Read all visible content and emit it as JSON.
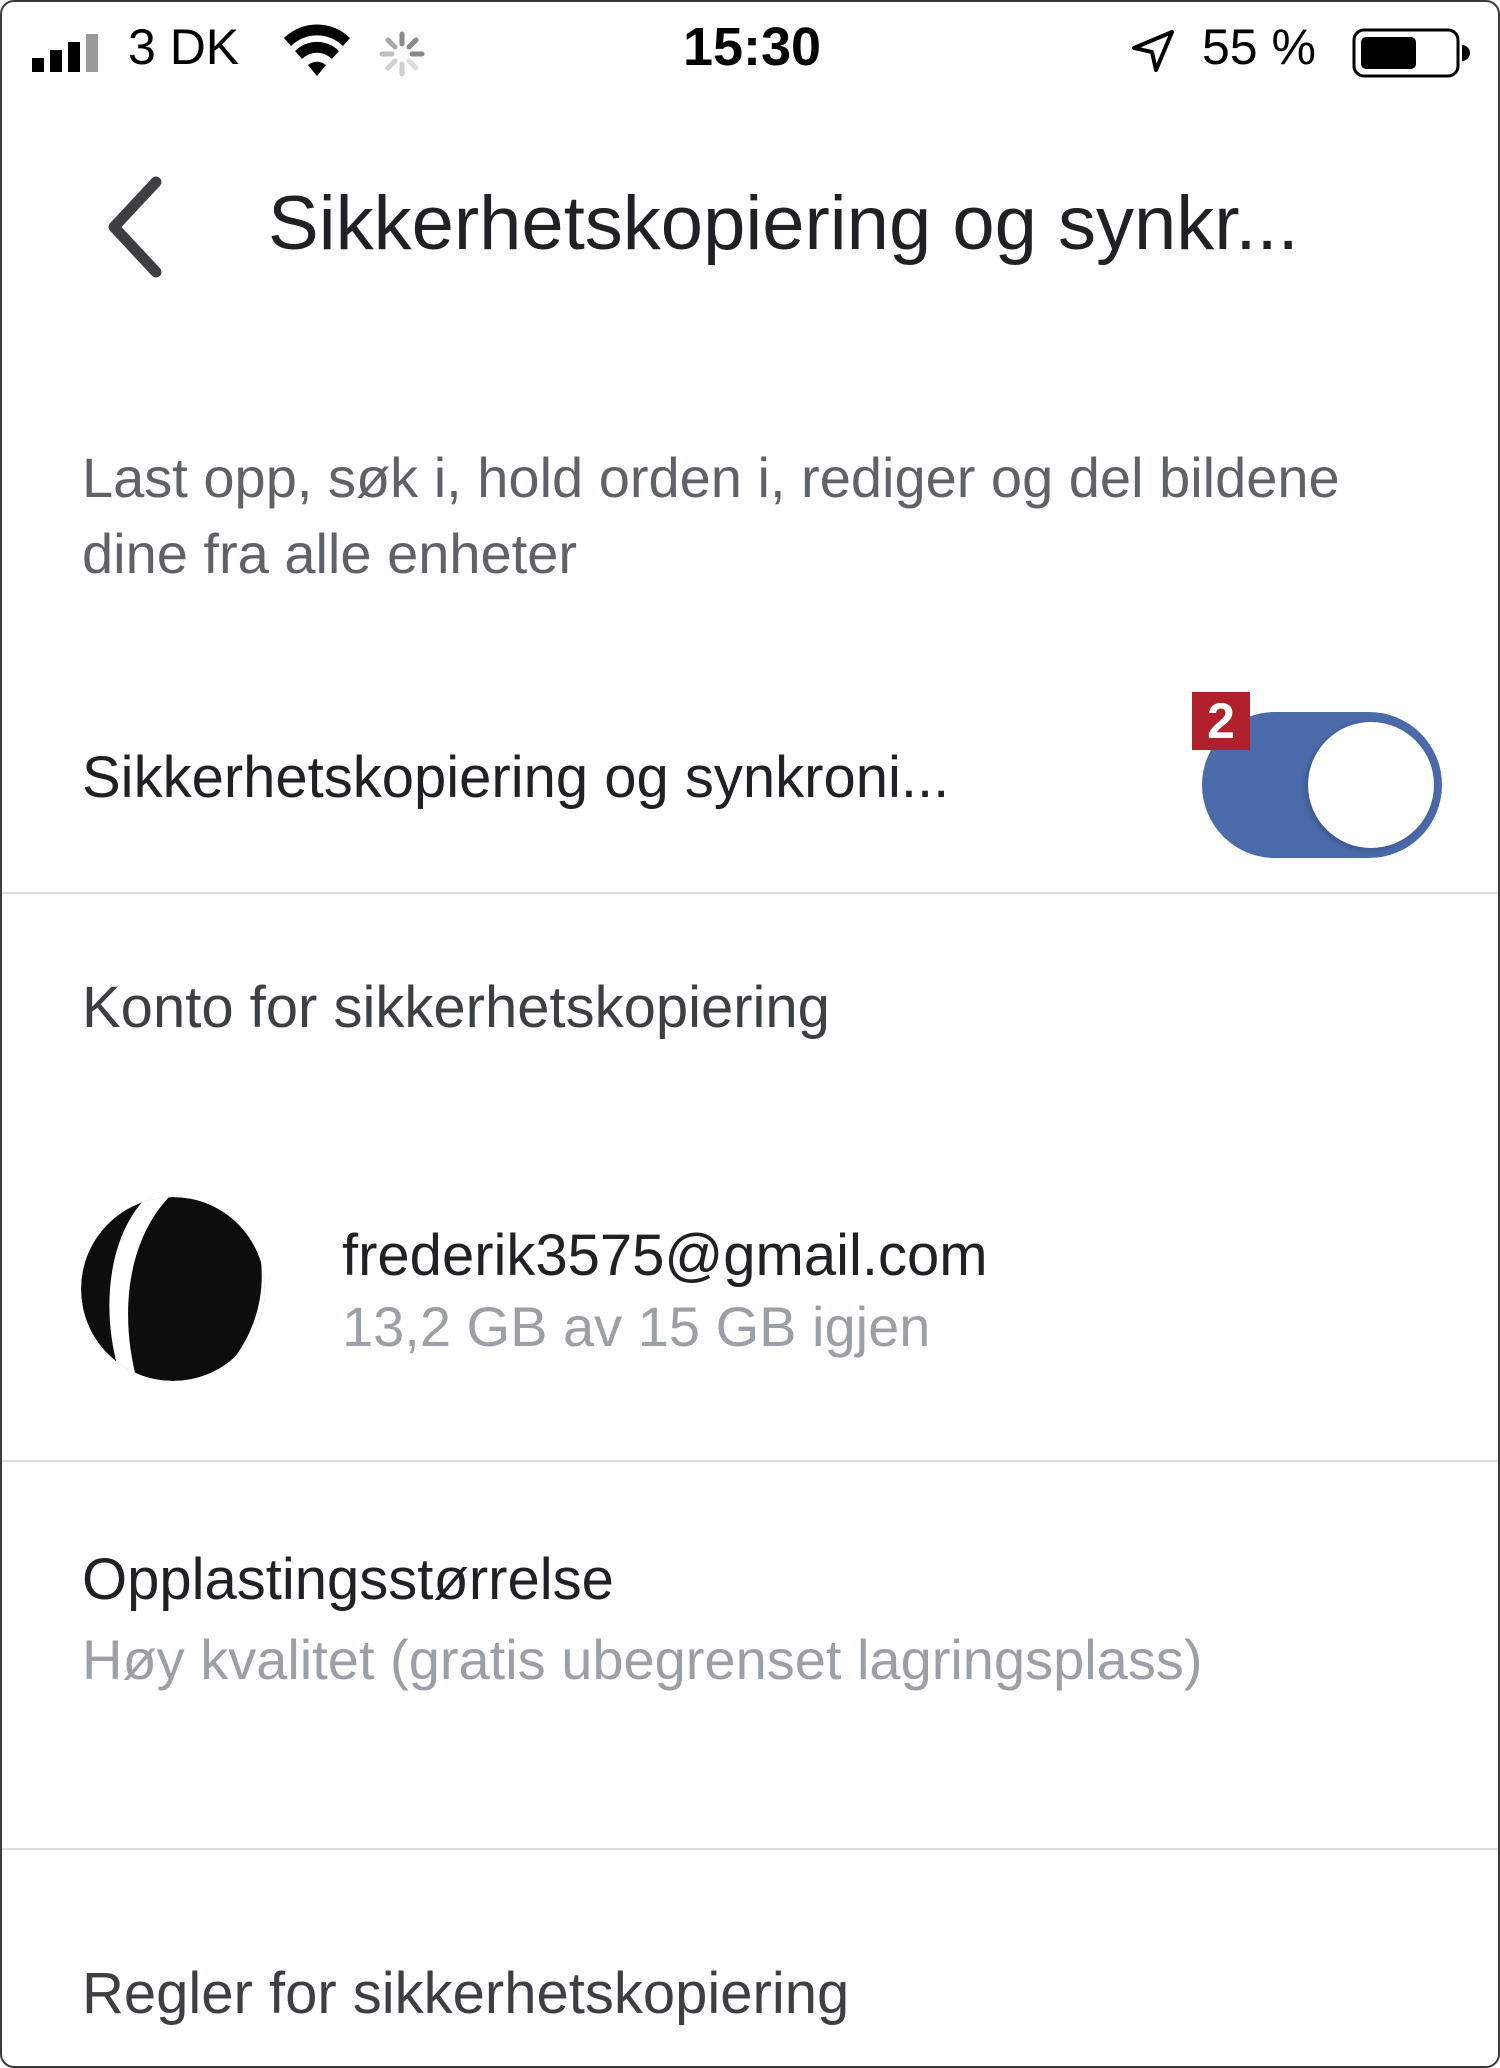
{
  "status_bar": {
    "carrier": "3 DK",
    "time": "15:30",
    "battery_percent": "55 %",
    "battery_level": 0.55
  },
  "header": {
    "title": "Sikkerhetskopiering og synkr..."
  },
  "description": "Last opp, søk i, hold orden i, rediger og del bildene dine fra alle enheter",
  "backup_toggle": {
    "label": "Sikkerhetskopiering og synkroni...",
    "badge": "2",
    "enabled": true
  },
  "account_section": {
    "header": "Konto for sikkerhetskopiering",
    "email": "frederik3575@gmail.com",
    "quota": "13,2 GB av 15 GB igjen"
  },
  "upload_size": {
    "title": "Opplastingsstørrelse",
    "value": "Høy kvalitet (gratis ubegrenset lagringsplass)"
  },
  "rules": {
    "label": "Regler for sikkerhetskopiering"
  },
  "colors": {
    "toggle_on": "#4a6aaa",
    "badge": "#b0202a",
    "secondary_text": "#9aa0a6"
  }
}
